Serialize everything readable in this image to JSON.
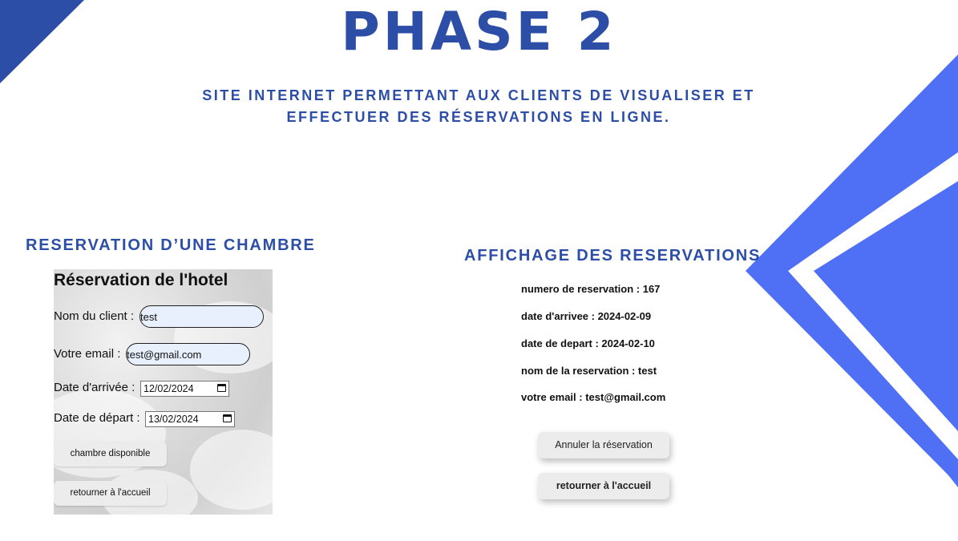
{
  "slide": {
    "title": "PHASE 2",
    "subtitle_line1": "SITE INTERNET PERMETTANT AUX CLIENTS DE VISUALISER ET",
    "subtitle_line2": "EFFECTUER DES RÉSERVATIONS EN LIGNE.",
    "accent_color": "#2d4ea6",
    "bright_blue": "#4f6ff5"
  },
  "left_section": {
    "title": "RESERVATION D’UNE CHAMBRE",
    "form": {
      "heading": "Réservation de l'hotel",
      "client_label": "Nom du client :",
      "client_value": "test",
      "email_label": "Votre email :",
      "email_value": "test@gmail.com",
      "arrival_label": "Date d'arrivée :",
      "arrival_value": "12/02/2024",
      "departure_label": "Date de départ :",
      "departure_value": "13/02/2024",
      "available_button": "chambre disponible",
      "home_button": "retourner à l'accueil"
    }
  },
  "right_section": {
    "title": "AFFICHAGE DES RESERVATIONS",
    "lines": [
      "numero de reservation : 167",
      "date d'arrivee : 2024-02-09",
      "date de depart : 2024-02-10",
      "nom de la reservation : test",
      "votre email : test@gmail.com"
    ],
    "cancel_button": "Annuler la réservation",
    "home_button": "retourner à l'accueil"
  }
}
